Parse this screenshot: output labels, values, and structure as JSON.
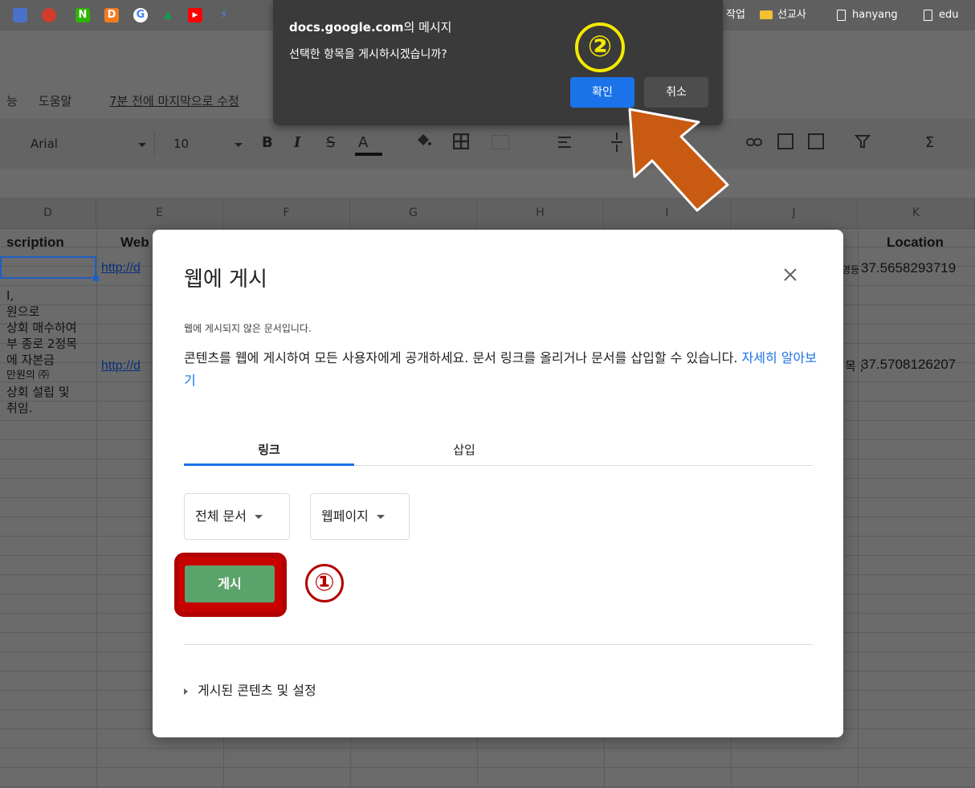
{
  "bookmarks": {
    "icons": [
      {
        "name": "bookmark-icon-1",
        "glyph": "",
        "color": "#4a70c8"
      },
      {
        "name": "bookmark-icon-2",
        "glyph": "",
        "color": "#d23c2a"
      },
      {
        "name": "naver-icon",
        "glyph": "N",
        "color": "#2db400"
      },
      {
        "name": "d-icon",
        "glyph": "D",
        "color": "#f47a20"
      },
      {
        "name": "google-icon",
        "glyph": "G",
        "color": "#4285f4"
      },
      {
        "name": "drive-icon",
        "glyph": "▲",
        "color": "#0f9d58"
      },
      {
        "name": "youtube-icon",
        "glyph": "▶",
        "color": "#ff0000"
      },
      {
        "name": "bolt-icon",
        "glyph": "⚡",
        "color": "#4a8af4"
      }
    ],
    "right_items": [
      "작업",
      "선교사",
      "hanyang",
      "edu"
    ]
  },
  "menu": {
    "items": [
      "능",
      "도움말"
    ],
    "last_edit": "7분 전에 마지막으로 수정"
  },
  "toolbar": {
    "font": "Arial",
    "font_size": "10",
    "bold": "B",
    "italic": "I",
    "strike": "S",
    "text_color": "A",
    "sigma": "Σ"
  },
  "columns": [
    "D",
    "E",
    "F",
    "G",
    "H",
    "I",
    "J",
    "K"
  ],
  "sheet": {
    "header_description": "scription",
    "header_web": "Web",
    "header_location": "Location",
    "row1_link": "http://d",
    "row1_location": "37.5658293719",
    "row1_j_fragment": "명등",
    "row2_desc": [
      "I,",
      "원으로",
      "상회 매수하여",
      "부 종로 2정목",
      "에 자본금",
      "만원의 ㈜",
      "상회 설립 및",
      "취임."
    ],
    "row2_link": "http://d",
    "row2_location": "37.5708126207",
    "row2_j_fragment": "목 ;"
  },
  "dialog": {
    "title": "웹에 게시",
    "note": "웹에 게시되지 않은 문서입니다.",
    "description": "콘텐츠를 웹에 게시하여 모든 사용자에게 공개하세요. 문서 링크를 올리거나 문서를 삽입할 수 있습니다.",
    "learn_more": "자세히 알아보기",
    "tabs": [
      "링크",
      "삽입"
    ],
    "select_scope": "전체 문서",
    "select_format": "웹페이지",
    "publish_button": "게시",
    "annotation_1": "①",
    "published_settings": "게시된 콘텐츠 및 설정"
  },
  "confirm": {
    "title_domain": "docs.google.com",
    "title_suffix": "의 메시지",
    "message": "선택한 항목을 게시하시겠습니까?",
    "ok": "확인",
    "cancel": "취소",
    "annotation_2": "②"
  },
  "colors": {
    "accent": "#1a73e8",
    "publish_green": "#5aa36a",
    "highlight_red": "#b30000",
    "annotation_yellow": "#f5ea00",
    "arrow_orange": "#c85a12"
  }
}
